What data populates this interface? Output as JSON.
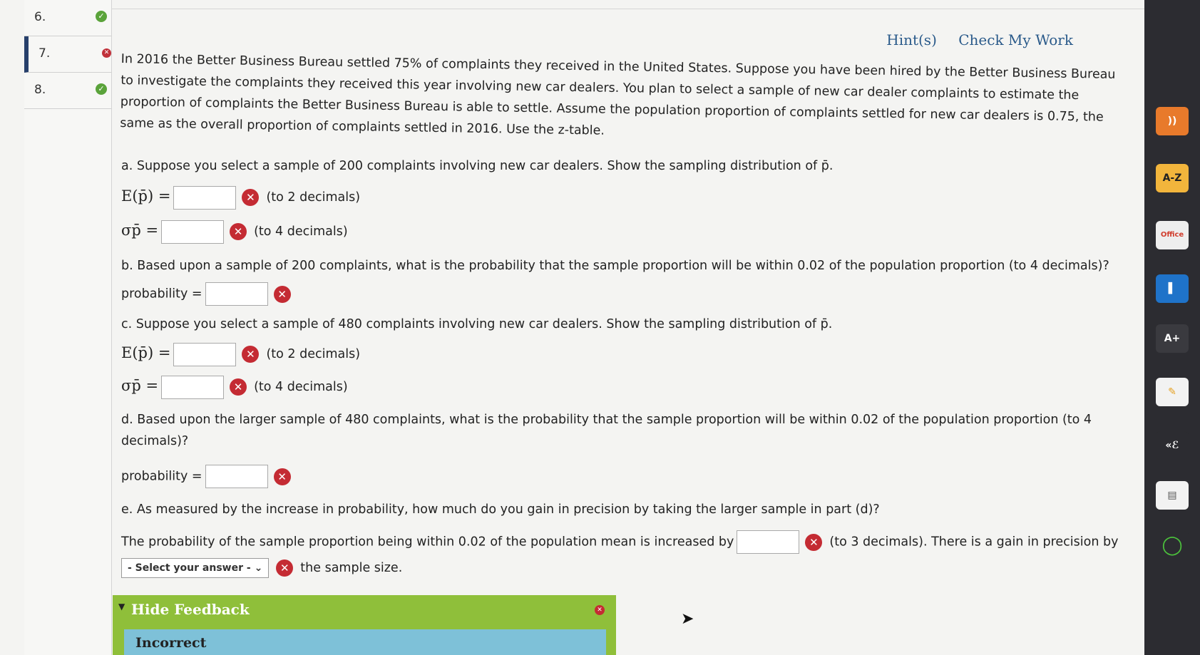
{
  "question_nav": [
    {
      "number": "6.",
      "status": "correct"
    },
    {
      "number": "7.",
      "status": "incorrect"
    },
    {
      "number": "8.",
      "status": "correct"
    }
  ],
  "header": {
    "hints": "Hint(s)",
    "check": "Check My Work"
  },
  "intro": "In 2016 the Better Business Bureau settled 75% of complaints they received in the United States. Suppose you have been hired by the Better Business Bureau to investigate the complaints they received this year involving new car dealers. You plan to select a sample of new car dealer complaints to estimate the proportion of complaints the Better Business Bureau is able to settle. Assume the population proportion of complaints settled for new car dealers is 0.75, the same as the overall proportion of complaints settled in 2016. Use the z-table.",
  "part_a": {
    "text": "a. Suppose you select a sample of 200 complaints involving new car dealers. Show the sampling distribution of p̄.",
    "e_label": "E(p̄) =",
    "e_note": "(to 2 decimals)",
    "s_label": "σp̄ =",
    "s_note": "(to 4 decimals)"
  },
  "part_b": {
    "text": "b. Based upon a sample of 200 complaints, what is the probability that the sample proportion will be within 0.02 of the population proportion (to 4 decimals)?",
    "label": "probability ="
  },
  "part_c": {
    "text": "c. Suppose you select a sample of 480 complaints involving new car dealers. Show the sampling distribution of p̄.",
    "e_label": "E(p̄) =",
    "e_note": "(to 2 decimals)",
    "s_label": "σp̄ =",
    "s_note": "(to 4 decimals)"
  },
  "part_d": {
    "text1": "d. Based upon the larger sample of 480 complaints, what is the probability that the sample proportion will be within 0.02 of the population proportion (to 4",
    "text2": "decimals)?",
    "label": "probability ="
  },
  "part_e": {
    "text": "e. As measured by the increase in probability, how much do you gain in precision by taking the larger sample in part (d)?",
    "line1_pre": "The probability of the sample proportion being within 0.02 of the population mean is increased by",
    "line1_post": "(to 3 decimals). There is a gain in precision by",
    "select_label": "- Select your answer -",
    "line2_post": "the sample size."
  },
  "feedback": {
    "title": "Hide Feedback",
    "status": "Incorrect"
  },
  "colors": {
    "incorrect": "#c42b33",
    "correct": "#5aa33a",
    "feedback_bar": "#8fbf3a",
    "link": "#2a5a8a"
  },
  "toolbar": [
    "rss-icon",
    "A-Z",
    "office-icon",
    "book-icon",
    "A+",
    "pencil-icon",
    "audio-icon",
    "notes-icon",
    "loop-icon"
  ]
}
